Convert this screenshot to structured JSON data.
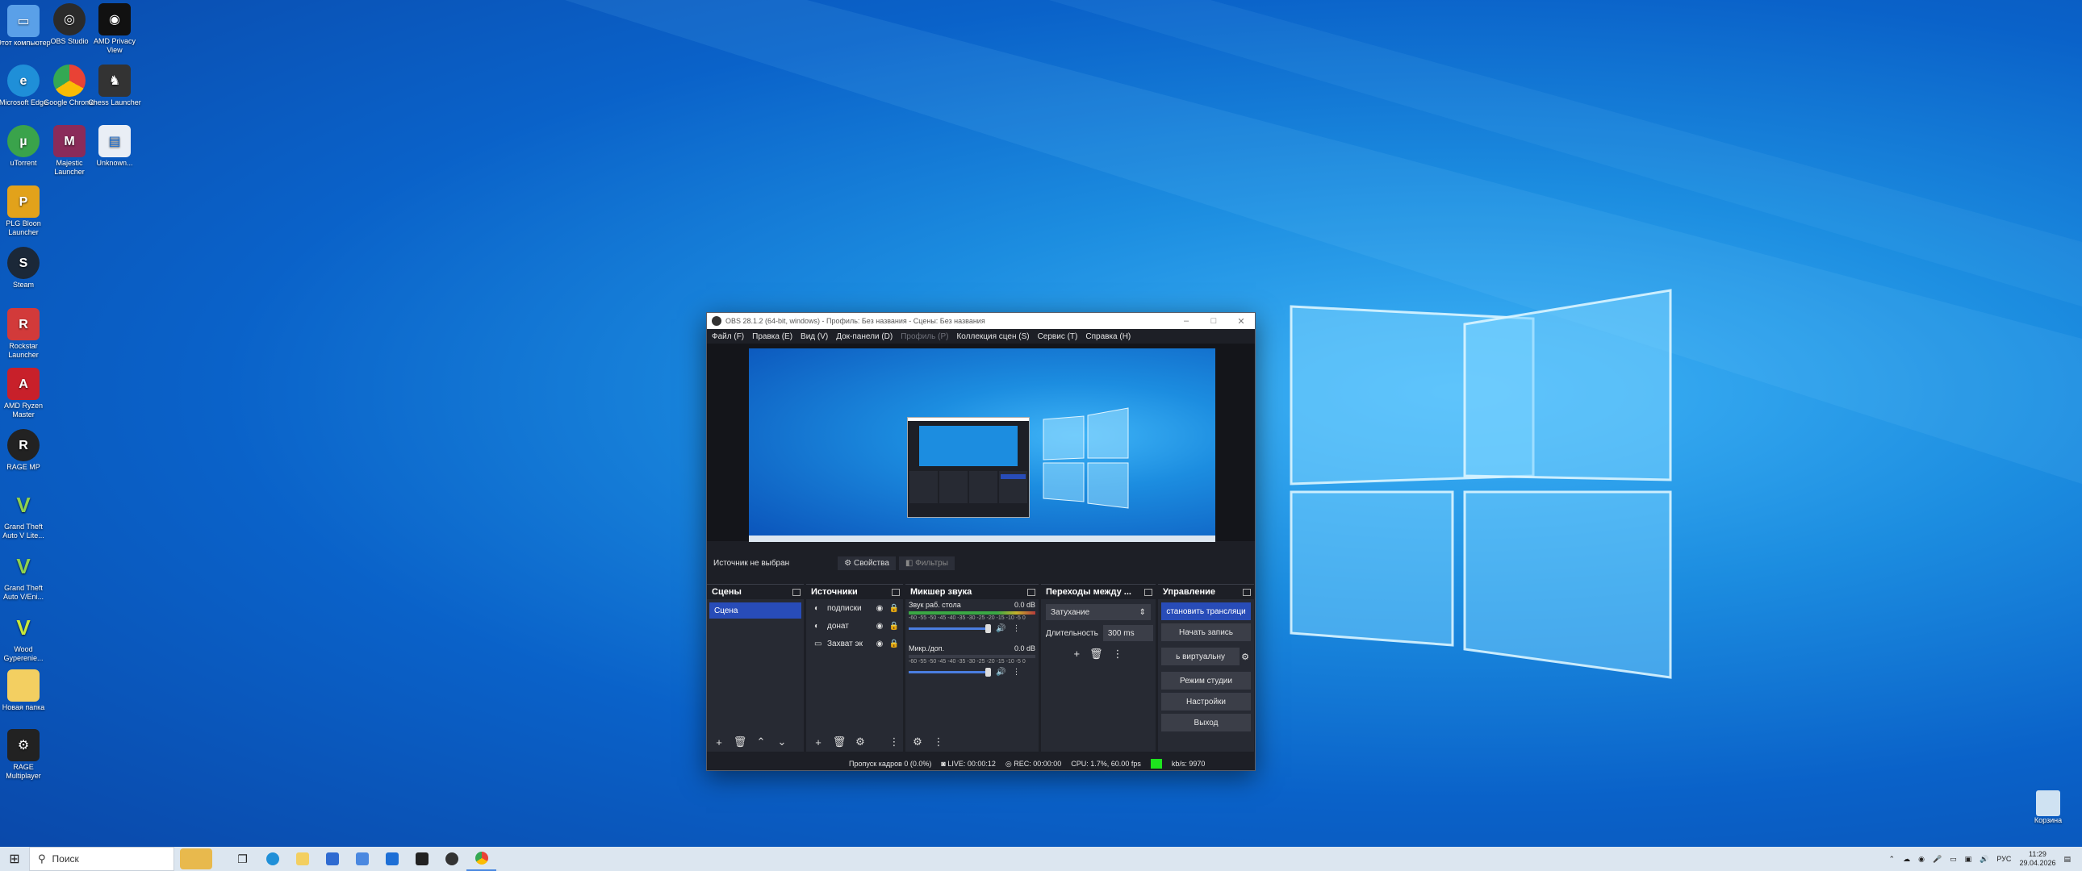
{
  "desktop": {
    "icons": [
      {
        "label": "Этот компьютер",
        "icon": "computer-icon",
        "color": "#5aa0e8"
      },
      {
        "label": "OBS Studio",
        "icon": "obs-icon",
        "color": "#2b2b2b"
      },
      {
        "label": "AMD Privacy View",
        "icon": "amd-privacy-icon",
        "color": "#111111"
      },
      {
        "label": "Microsoft Edge",
        "icon": "edge-icon",
        "color": "#1f8fd8"
      },
      {
        "label": "Google Chrome",
        "icon": "chrome-icon",
        "color": "#e94235"
      },
      {
        "label": "Chess Launcher",
        "icon": "chess-icon",
        "color": "#333333"
      },
      {
        "label": "uTorrent",
        "icon": "utorrent-icon",
        "color": "#3aa34b"
      },
      {
        "label": "Majestic Launcher",
        "icon": "majestic-icon",
        "color": "#8a2b5a"
      },
      {
        "label": "Unknown...",
        "icon": "file-icon",
        "color": "#e9eef5"
      },
      {
        "label": "PLG Bloon Launcher",
        "icon": "plg-icon",
        "color": "#e2a21b"
      },
      {
        "label": "Steam",
        "icon": "steam-icon",
        "color": "#1b2838"
      },
      {
        "label": "Rockstar Launcher",
        "icon": "rockstar-icon",
        "color": "#d23a3a"
      },
      {
        "label": "AMD Ryzen Master",
        "icon": "amd-ryzen-icon",
        "color": "#c8202a"
      },
      {
        "label": "RAGE MP",
        "icon": "rage-icon",
        "color": "#222222"
      },
      {
        "label": "Grand Theft Auto V Lite...",
        "icon": "gta-icon",
        "color": "#3c7a30"
      },
      {
        "label": "Grand Theft Auto V/Eni...",
        "icon": "gta-icon",
        "color": "#3c7a30"
      },
      {
        "label": "Wood Gyperenie...",
        "icon": "gta-icon",
        "color": "#3c7a30"
      },
      {
        "label": "Новая папка",
        "icon": "folder-icon",
        "color": "#f3cf61"
      },
      {
        "label": "RAGE Multiplayer",
        "icon": "rage-mp-icon",
        "color": "#222222"
      }
    ],
    "recycle_label": "Корзина"
  },
  "obs": {
    "title": "OBS 28.1.2 (64-bit, windows) - Профиль: Без названия - Сцены: Без названия",
    "menu": [
      "Файл (F)",
      "Правка (E)",
      "Вид (V)",
      "Док-панели (D)",
      "Профиль (P)",
      "Коллекция сцен (S)",
      "Сервис (T)",
      "Справка (H)"
    ],
    "source_bar": {
      "none_selected": "Источник не выбран",
      "properties": "Свойства",
      "filters": "Фильтры"
    },
    "scenes": {
      "title": "Сцены",
      "items": [
        "Сцена"
      ]
    },
    "sources": {
      "title": "Источники",
      "items": [
        "подписки",
        "донат",
        "Захват эк"
      ]
    },
    "mixer": {
      "title": "Микшер звука",
      "channels": [
        {
          "name": "Звук раб. стола",
          "db": "0.0 dB",
          "scale": "-60 -55 -50 -45 -40 -35 -30 -25 -20 -15 -10 -5 0",
          "level": 0.7
        },
        {
          "name": "Микр./доп.",
          "db": "0.0 dB",
          "scale": "-60 -55 -50 -45 -40 -35 -30 -25 -20 -15 -10 -5 0",
          "level": 0
        }
      ]
    },
    "transitions": {
      "title": "Переходы между ...",
      "selected": "Затухание",
      "duration_label": "Длительность",
      "duration": "300 ms"
    },
    "controls": {
      "title": "Управление",
      "stream": "становить трансляци",
      "record": "Начать запись",
      "virtual_cam": "ь виртуальну",
      "studio": "Режим студии",
      "settings": "Настройки",
      "exit": "Выход"
    },
    "status": {
      "dropped": "Пропуск кадров 0 (0.0%)",
      "live": "LIVE: 00:00:12",
      "rec": "REC: 00:00:00",
      "cpu": "CPU: 1.7%, 60.00 fps",
      "kbps": "kb/s: 9970"
    }
  },
  "taskbar": {
    "search_placeholder": "Поиск",
    "lang": "РУС",
    "time": "11:29",
    "date": "29.04.2026"
  }
}
